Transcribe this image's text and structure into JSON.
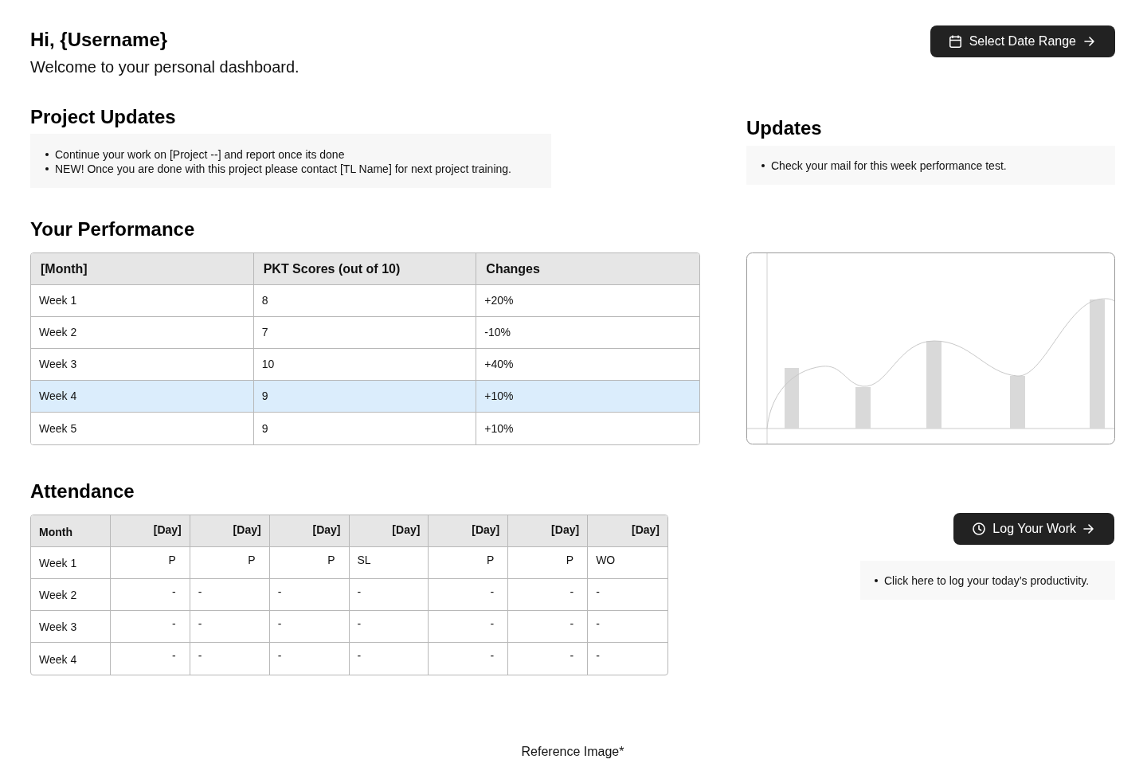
{
  "greeting": {
    "title": "Hi, {Username}",
    "subtitle": "Welcome to your personal dashboard."
  },
  "date_range_button": {
    "label": "Select Date Range"
  },
  "project_updates": {
    "title": "Project Updates",
    "items": [
      "Continue your work on [Project --] and report once its done",
      "NEW! Once you are done with this project please contact [TL Name] for next project training."
    ]
  },
  "updates": {
    "title": "Updates",
    "items": [
      "Check your mail for this week performance test."
    ]
  },
  "performance": {
    "title": "Your Performance",
    "columns": [
      "[Month]",
      "PKT Scores (out of 10)",
      "Changes"
    ],
    "rows": [
      {
        "cells": [
          "Week 1",
          "8",
          "+20%"
        ],
        "selected": false
      },
      {
        "cells": [
          "Week 2",
          "7",
          "-10%"
        ],
        "selected": false
      },
      {
        "cells": [
          "Week 3",
          "10",
          "+40%"
        ],
        "selected": false
      },
      {
        "cells": [
          "Week 4",
          "9",
          "+10%"
        ],
        "selected": true
      },
      {
        "cells": [
          "Week 5",
          "9",
          "+10%"
        ],
        "selected": false
      }
    ]
  },
  "attendance": {
    "title": "Attendance",
    "columns": [
      "Month",
      "[Day]",
      "[Day]",
      "[Day]",
      "[Day]",
      "[Day]",
      "[Day]",
      "[Day]"
    ],
    "rows": [
      [
        "Week 1",
        "P",
        "P",
        "P",
        "SL",
        "P",
        "P",
        "WO"
      ],
      [
        "Week 2",
        "-",
        "-",
        "-",
        "-",
        "-",
        "-",
        "-"
      ],
      [
        "Week 3",
        "-",
        "-",
        "-",
        "-",
        "-",
        "-",
        "-"
      ],
      [
        "Week 4",
        "-",
        "-",
        "-",
        "-",
        "-",
        "-",
        "-"
      ]
    ]
  },
  "log_work": {
    "button": "Log Your Work",
    "items": [
      "Click here to log your today’s productivity."
    ]
  },
  "footer": {
    "note": "Reference Image*"
  }
}
